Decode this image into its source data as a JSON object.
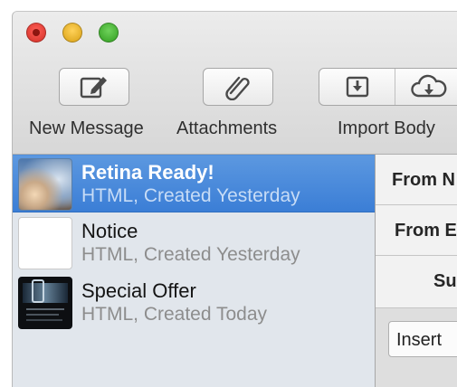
{
  "toolbar": {
    "new_message": "New Message",
    "attachments": "Attachments",
    "import_body": "Import Body"
  },
  "messages": [
    {
      "title": "Retina Ready!",
      "subtitle": "HTML, Created Yesterday",
      "thumbnail": "cloud-sky-image",
      "selected": true
    },
    {
      "title": "Notice",
      "subtitle": "HTML, Created Yesterday",
      "thumbnail": "blank-page",
      "selected": false
    },
    {
      "title": "Special Offer",
      "subtitle": "HTML, Created Today",
      "thumbnail": "dark-newsletter-image",
      "selected": false
    }
  ],
  "fields": {
    "from_name": "From N",
    "from_email": "From E",
    "subject": "Su"
  },
  "insert_label": "Insert",
  "colors": {
    "selection": "#3b7ed6",
    "sidebar_bg": "#e1e6ec"
  }
}
